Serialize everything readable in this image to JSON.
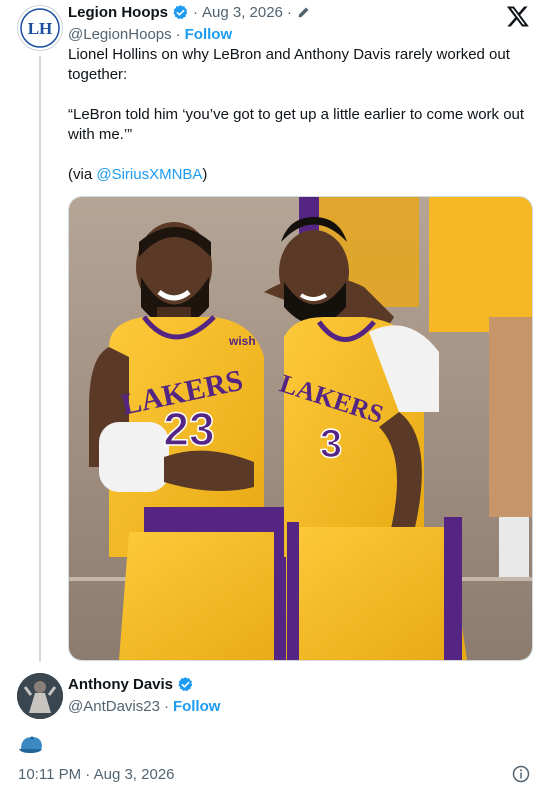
{
  "tweet": {
    "author_name": "Legion Hoops",
    "author_handle": "@LegionHoops",
    "date": "Aug 3, 2026",
    "date_sep": "·",
    "follow_label": "Follow",
    "text_line1": "Lionel Hollins on why LeBron and Anthony Davis rarely worked out together:",
    "text_quote": "“LeBron told him ‘you’ve got to get up a little earlier to come work out with me.’”",
    "via_prefix": "(via ",
    "via_link": "@SiriusXMNBA",
    "via_suffix": ")",
    "avatar_text": "LH",
    "image": {
      "left_jersey_team": "LAKERS",
      "left_jersey_number": "23",
      "right_jersey_team": "LAKERS",
      "right_jersey_number": "3",
      "jersey_patch": "wish"
    }
  },
  "reply_author": {
    "name": "Anthony Davis",
    "handle": "@AntDavis23",
    "follow_label": "Follow",
    "sep": "·"
  },
  "footer": {
    "time": "10:11 PM",
    "sep": "·",
    "date": "Aug 3, 2026"
  },
  "colors": {
    "accent": "#1d9bf0",
    "muted": "#536471",
    "lakers_gold": "#fdb927",
    "lakers_purple": "#552583"
  },
  "icons": [
    "verified-badge-icon",
    "edit-pencil-icon",
    "x-logo-icon",
    "cap-emoji-icon",
    "info-icon"
  ]
}
